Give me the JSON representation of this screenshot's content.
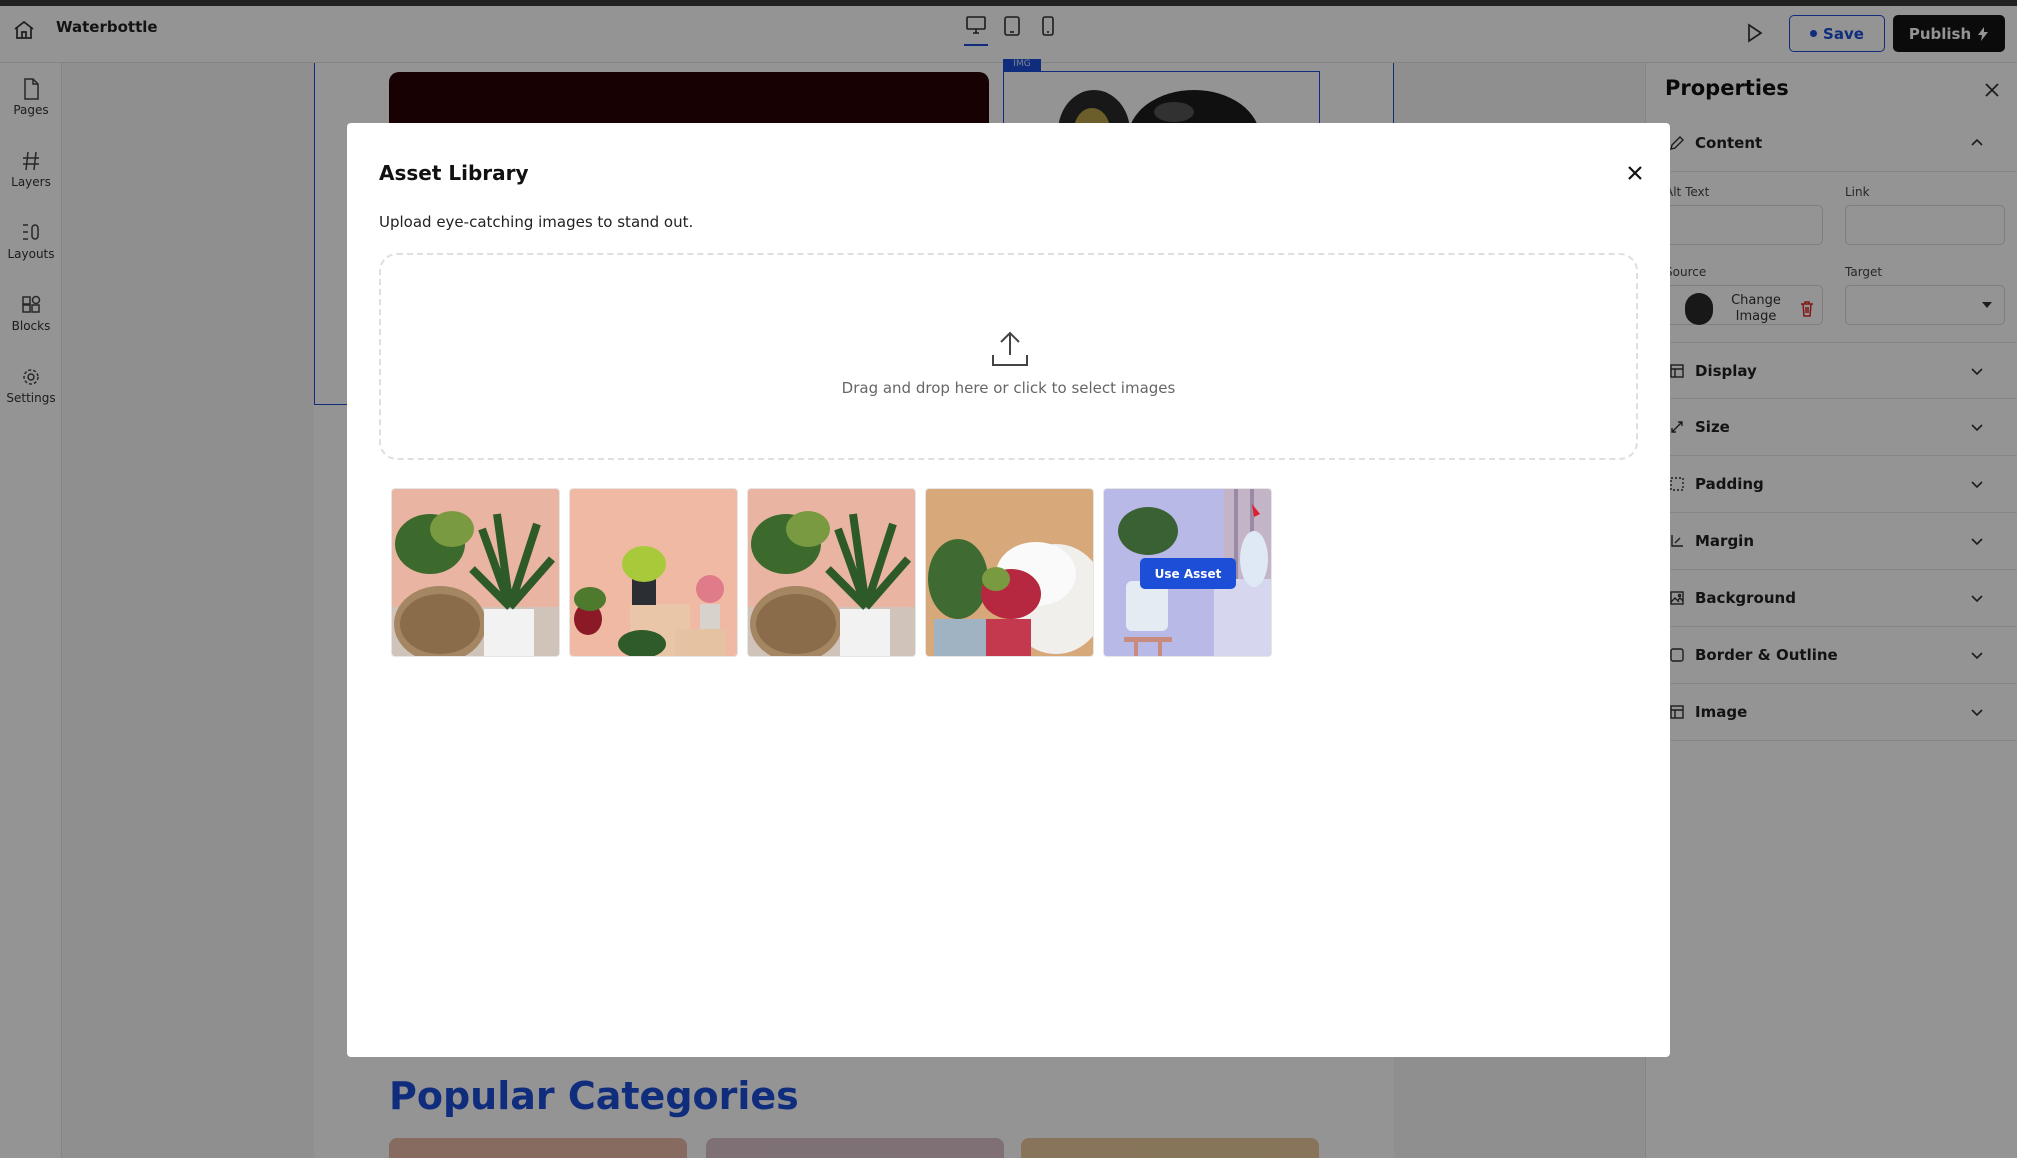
{
  "topbar": {
    "site_name": "Waterbottle",
    "devices": [
      "desktop-icon",
      "tablet-icon",
      "mobile-icon"
    ],
    "save_label": "Save",
    "publish_label": "Publish"
  },
  "left_rail": {
    "items": [
      {
        "label": "Pages",
        "icon": "file-icon"
      },
      {
        "label": "Layers",
        "icon": "hash-icon"
      },
      {
        "label": "Layouts",
        "icon": "layouts-icon"
      },
      {
        "label": "Blocks",
        "icon": "blocks-icon"
      },
      {
        "label": "Settings",
        "icon": "gear-icon"
      }
    ]
  },
  "canvas": {
    "image_tag": "IMG",
    "section_title": "Popular Categories"
  },
  "properties": {
    "title": "Properties",
    "content": {
      "label": "Content",
      "alt_text_label": "Alt Text",
      "link_label": "Link",
      "source_label": "Source",
      "target_label": "Target",
      "change_image_label": "Change Image"
    },
    "sections": [
      {
        "label": "Display",
        "icon": "layout-icon"
      },
      {
        "label": "Size",
        "icon": "resize-icon"
      },
      {
        "label": "Padding",
        "icon": "padding-icon"
      },
      {
        "label": "Margin",
        "icon": "margin-icon"
      },
      {
        "label": "Background",
        "icon": "image-icon"
      },
      {
        "label": "Border & Outline",
        "icon": "border-icon"
      },
      {
        "label": "Image",
        "icon": "layout-icon"
      }
    ]
  },
  "modal": {
    "title": "Asset Library",
    "subtitle": "Upload eye-catching images to stand out.",
    "dropzone_text": "Drag and drop here or click to select images",
    "use_asset_label": "Use Asset",
    "assets": [
      {
        "name": "plants-on-pouf"
      },
      {
        "name": "small-potted-plants"
      },
      {
        "name": "plants-on-pouf"
      },
      {
        "name": "plants-with-pillows"
      },
      {
        "name": "bonsai-on-side-table"
      }
    ]
  },
  "colors": {
    "accent": "#1d4ed8",
    "publish_bg": "#141414",
    "hero_dark": "#2a0305"
  }
}
